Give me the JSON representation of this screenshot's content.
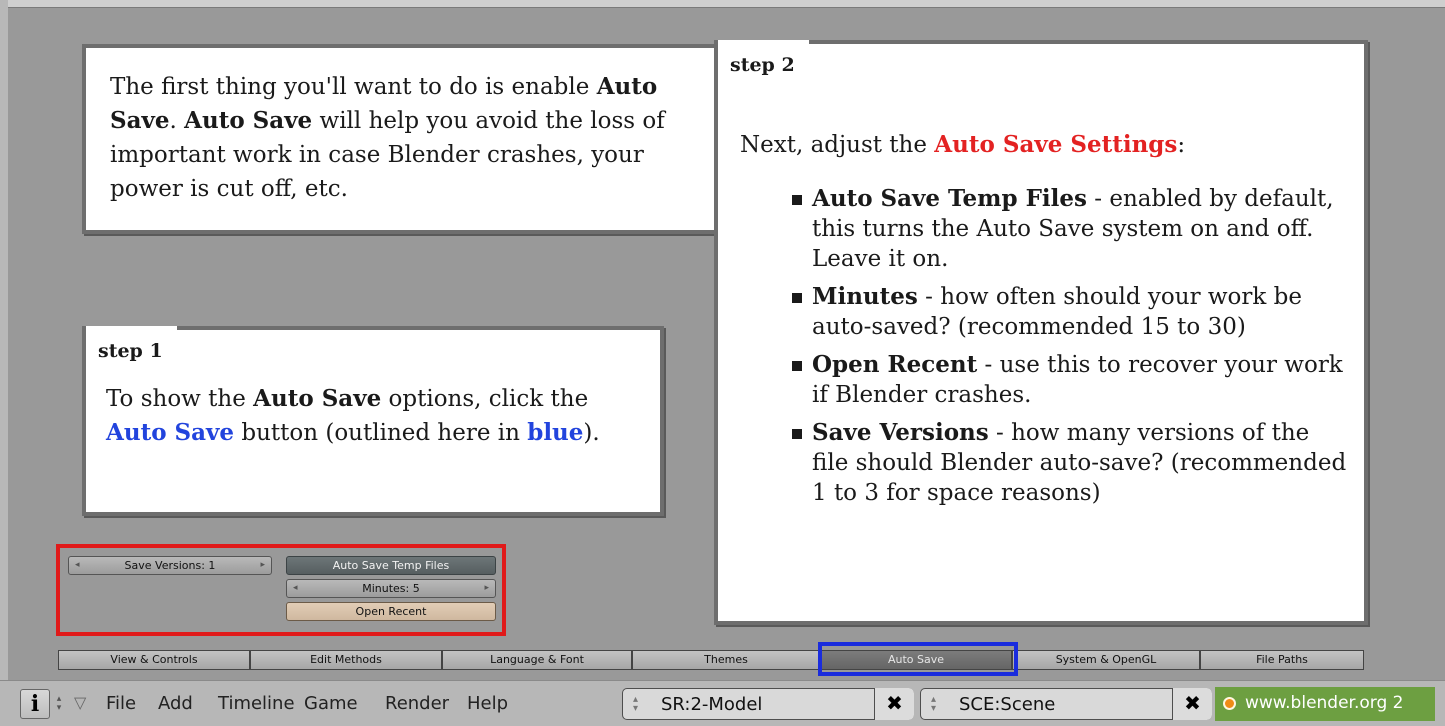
{
  "intro": {
    "p1": "The first thing you'll want to do is enable ",
    "b1": "Auto Save",
    "p2": ". ",
    "b2": "Auto Save",
    "p3": " will help you avoid the loss of important work in case Blender crashes, your power is cut off, etc."
  },
  "step1": {
    "tab": "step 1",
    "t1": "To show the ",
    "b1": "Auto Save",
    "t2": " options, click the ",
    "link": "Auto Save",
    "t3": " button (outlined here in ",
    "blue_word": "blue",
    "t4": ")."
  },
  "step2": {
    "tab": "step 2",
    "t1": "Next, adjust the ",
    "highlight": "Auto Save Settings",
    "t2": ":",
    "items": [
      {
        "term": "Auto Save Temp Files",
        "desc": " - enabled by default, this turns the Auto Save system on and off. Leave it on."
      },
      {
        "term": "Minutes",
        "desc": " - how often should your work be auto-saved? (recommended 15 to 30)"
      },
      {
        "term": "Open Recent",
        "desc": " - use this to recover your work if Blender crashes."
      },
      {
        "term": "Save Versions",
        "desc": " - how many versions of the file should Blender auto-save? (recommended 1 to 3 for space reasons)"
      }
    ]
  },
  "widgets": {
    "save_versions": "Save Versions: 1",
    "auto_save_temp": "Auto Save Temp Files",
    "minutes": "Minutes: 5",
    "open_recent": "Open Recent"
  },
  "tabs": [
    "View & Controls",
    "Edit Methods",
    "Language & Font",
    "Themes",
    "Auto Save",
    "System & OpenGL",
    "File Paths"
  ],
  "header": {
    "info_icon": "i",
    "menus": [
      "File",
      "Add",
      "Timeline",
      "Game",
      "Render",
      "Help"
    ],
    "screen": "SR:2-Model",
    "scene": "SCE:Scene",
    "url": "www.blender.org 2"
  },
  "colors": {
    "highlight_red": "#e32222",
    "highlight_blue": "#2244dd",
    "outline_red": "#e01a1a",
    "outline_blue": "#1a2cdd"
  }
}
